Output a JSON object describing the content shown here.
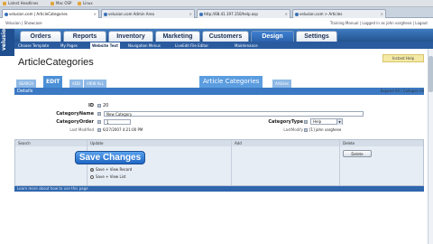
{
  "bookmarks": [
    {
      "label": "Latest Headlines"
    },
    {
      "label": "Mac OSP"
    },
    {
      "label": "Linux"
    }
  ],
  "browser_tabs": [
    {
      "label": "velusion.com | ArticleCategories",
      "active": true
    },
    {
      "label": "velusion.com Admin Area",
      "active": false
    },
    {
      "label": "http://68.41.197.150/help.asp",
      "active": false
    },
    {
      "label": "velusion.com > Articles",
      "active": false
    }
  ],
  "app_header": {
    "site_name": "Velusion | Showcase",
    "links": "Training Manual | Logged in as john varghese | Logout"
  },
  "logo": {
    "text": "velusion"
  },
  "main_nav": [
    "Orders",
    "Reports",
    "Inventory",
    "Marketing",
    "Customers",
    "Design",
    "Settings"
  ],
  "main_nav_active": "Design",
  "sub_nav": [
    "Choose Template",
    "My Pages",
    "Website Text",
    "Navigation Menus",
    "LiveEdit File Editor",
    "Maintenance"
  ],
  "sub_nav_active": "Website Text",
  "page": {
    "title": "ArticleCategories",
    "instant_help": "Instant Help"
  },
  "mode_tabs": [
    "SEARCH",
    "EDIT",
    "ADD",
    "VIEW ALL"
  ],
  "mode_active": "EDIT",
  "group_tabs": {
    "primary": "Article Categories",
    "secondary": "Articles"
  },
  "details": {
    "label": "Details",
    "expand_links": "Expand All / Collapse All"
  },
  "form": {
    "id_label": "ID",
    "id_value": "20",
    "name_label": "CategoryName",
    "name_value": "New Category",
    "order_label": "CategoryOrder",
    "order_value": "1",
    "last_modified_label": "Last Modified",
    "last_modified_value": "6/27/2007 4:21:00 PM",
    "type_label": "CategoryType",
    "type_value": "Help",
    "last_modify_label": "LastModify",
    "last_modify_value": "[1] john varghese"
  },
  "actions": {
    "search_label": "Search",
    "update_label": "Update",
    "add_label": "Add",
    "delete_label": "Delete",
    "save_button": "Save Changes",
    "radio_1": "Save + View Record",
    "radio_2": "Save + View List",
    "delete_button": "Delete"
  },
  "footer": {
    "text": "Learn more about how to use this page"
  }
}
